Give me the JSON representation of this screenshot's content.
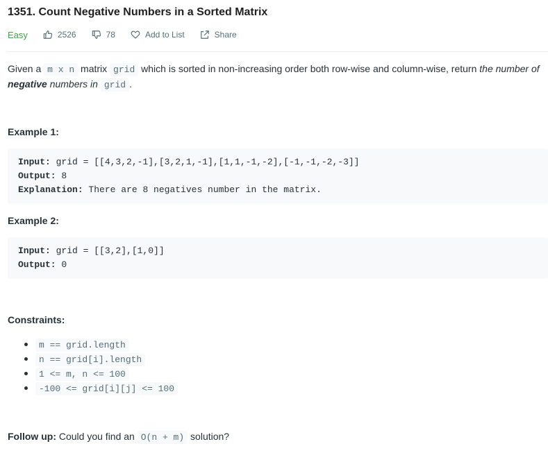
{
  "problem": {
    "title": "1351. Count Negative Numbers in a Sorted Matrix",
    "difficulty": "Easy",
    "likes": "2526",
    "dislikes": "78",
    "add_to_list": "Add to List",
    "share": "Share"
  },
  "description": {
    "p1": "Given a ",
    "c1": "m x n",
    "p2": " matrix ",
    "c2": "grid",
    "p3": " which is sorted in non-increasing order both row-wise and column-wise, return ",
    "em1": "the number of ",
    "strong1": "negative",
    "em2": " numbers in",
    "p4": " ",
    "c3": "grid",
    "p5": "."
  },
  "examples": [
    {
      "heading": "Example 1:",
      "input_label": "Input:",
      "input_value": " grid = [[4,3,2,-1],[3,2,1,-1],[1,1,-1,-2],[-1,-1,-2,-3]]",
      "output_label": "Output:",
      "output_value": " 8",
      "explanation_label": "Explanation:",
      "explanation_value": " There are 8 negatives number in the matrix."
    },
    {
      "heading": "Example 2:",
      "input_label": "Input:",
      "input_value": " grid = [[3,2],[1,0]]",
      "output_label": "Output:",
      "output_value": " 0"
    }
  ],
  "constraints": {
    "heading": "Constraints:",
    "items": [
      "m == grid.length",
      "n == grid[i].length",
      "1 <= m, n <= 100",
      "-100 <= grid[i][j] <= 100"
    ]
  },
  "follow_up": {
    "label": "Follow up:",
    "text1": " Could you find an ",
    "code": "O(n + m)",
    "text2": " solution?"
  },
  "colors": {
    "easy": "#43a047",
    "code_bg": "#f7f9fa",
    "muted": "#546e7a"
  },
  "icons": [
    "thumbs-up-icon",
    "thumbs-down-icon",
    "heart-icon",
    "share-icon"
  ]
}
